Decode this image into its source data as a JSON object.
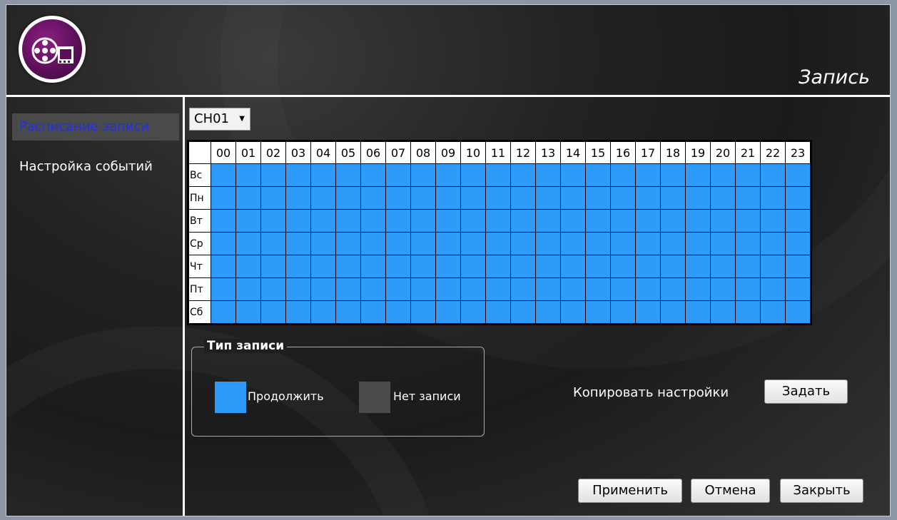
{
  "header": {
    "title": "Запись"
  },
  "sidebar": {
    "items": [
      {
        "label": "Расписание записи",
        "active": true
      },
      {
        "label": "Настройка событий",
        "active": false
      }
    ]
  },
  "channel": {
    "selected": "CH01"
  },
  "schedule": {
    "hours": [
      "00",
      "01",
      "02",
      "03",
      "04",
      "05",
      "06",
      "07",
      "08",
      "09",
      "10",
      "11",
      "12",
      "13",
      "14",
      "15",
      "16",
      "17",
      "18",
      "19",
      "20",
      "21",
      "22",
      "23"
    ],
    "days": [
      "Вс",
      "Пн",
      "Вт",
      "Ср",
      "Чт",
      "Пт",
      "Сб"
    ],
    "cell_state": "Продолжить",
    "color_record": "#2e9bfa",
    "color_none": "#4b4b4b"
  },
  "legend": {
    "title": "Тип записи",
    "continue_label": "Продолжить",
    "none_label": "Нет записи"
  },
  "copy": {
    "label": "Копировать настройки",
    "button": "Задать"
  },
  "footer": {
    "apply": "Применить",
    "cancel": "Отмена",
    "close": "Закрыть"
  },
  "icons": {
    "logo": "film-reel-icon",
    "dropdown": "chevron-down-icon"
  }
}
